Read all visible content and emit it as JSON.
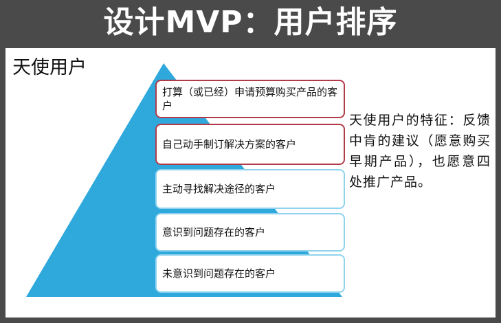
{
  "title": "设计MVP：用户排序",
  "panel_heading": "天使用户",
  "pyramid": {
    "fill_color": "#2fa8dc",
    "levels": [
      {
        "label": "打算（或已经）申请预算购买产品的客户",
        "highlight": true
      },
      {
        "label": "自己动手制订解决方案的客户",
        "highlight": true
      },
      {
        "label": "主动寻找解决途径的客户",
        "highlight": false
      },
      {
        "label": "意识到问题存在的客户",
        "highlight": false
      },
      {
        "label": "未意识到问题存在的客户",
        "highlight": false
      }
    ]
  },
  "description": "天使用户的特征：反馈中肯的建议（愿意购买早期产品），也愿意四处推广产品。",
  "colors": {
    "background": "#4a4a4a",
    "highlight_border": "#b23a48",
    "normal_border": "#8fd3ef"
  }
}
